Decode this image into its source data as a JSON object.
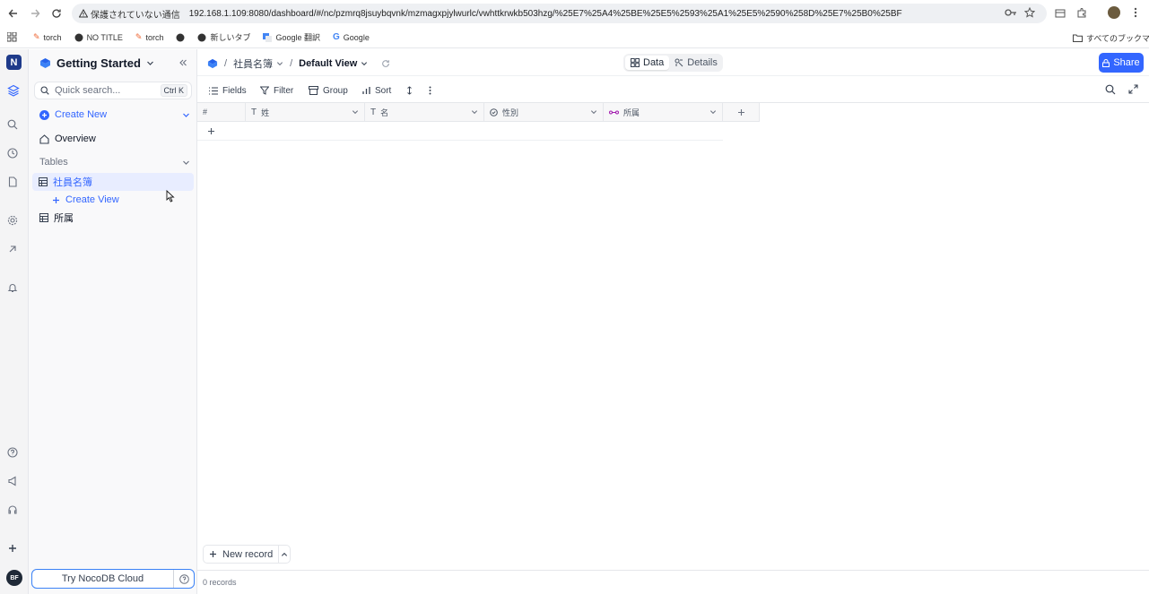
{
  "browser": {
    "url_warning": "保護されていない通信",
    "url": "192.168.1.109:8080/dashboard/#/nc/pzmrq8jsuybqvnk/mzmagxpjylwurlc/vwhttkrwkb503hzg/%25E7%25A4%25BE%25E5%2593%25A1%25E5%2590%258D%25E7%25B0%25BF",
    "bookmarks": [
      "torch",
      "NO TITLE",
      "torch",
      "",
      "新しいタブ",
      "Google 翻訳",
      "Google"
    ],
    "all_bookmarks": "すべてのブックマーク"
  },
  "sidebar": {
    "workspace_title": "Getting Started",
    "search_placeholder": "Quick search...",
    "search_shortcut": "Ctrl K",
    "create_new": "Create New",
    "overview": "Overview",
    "tables_heading": "Tables",
    "tables": [
      {
        "label": "社員名簿",
        "active": true
      },
      {
        "label": "所属",
        "active": false
      }
    ],
    "create_view": "Create View",
    "try_cloud": "Try NocoDB Cloud",
    "avatar_initials": "BF"
  },
  "header": {
    "breadcrumb_table": "社員名簿",
    "breadcrumb_view": "Default View",
    "tab_data": "Data",
    "tab_details": "Details",
    "share": "Share"
  },
  "toolbar": {
    "fields": "Fields",
    "filter": "Filter",
    "group": "Group",
    "sort": "Sort"
  },
  "grid": {
    "row_number_header": "#",
    "columns": [
      {
        "label": "姓",
        "type_icon": "text-type-icon"
      },
      {
        "label": "名",
        "type_icon": "text-type-icon"
      },
      {
        "label": "性別",
        "type_icon": "single-select-type-icon"
      },
      {
        "label": "所属",
        "type_icon": "link-type-icon"
      }
    ],
    "new_record": "New record",
    "records_count": "0 records"
  },
  "colors": {
    "accent": "#3366ff",
    "sidebar_bg": "#f9f9fa",
    "rail_bg": "#f4f4f5"
  }
}
